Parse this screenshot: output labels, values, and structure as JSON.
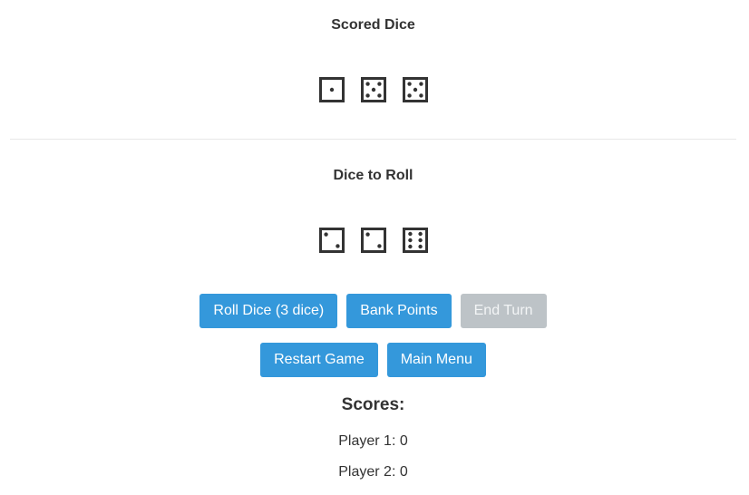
{
  "scored": {
    "title": "Scored Dice",
    "dice": [
      1,
      5,
      5
    ]
  },
  "to_roll": {
    "title": "Dice to Roll",
    "dice": [
      2,
      2,
      6
    ]
  },
  "buttons": {
    "roll": "Roll Dice (3 dice)",
    "bank": "Bank Points",
    "end_turn": "End Turn",
    "restart": "Restart Game",
    "main_menu": "Main Menu"
  },
  "scores": {
    "title": "Scores:",
    "players": [
      {
        "label": "Player 1: 0"
      },
      {
        "label": "Player 2: 0"
      }
    ]
  },
  "colors": {
    "button": "#3498db",
    "button_disabled": "#bdc3c7",
    "die_stroke": "#333333"
  }
}
